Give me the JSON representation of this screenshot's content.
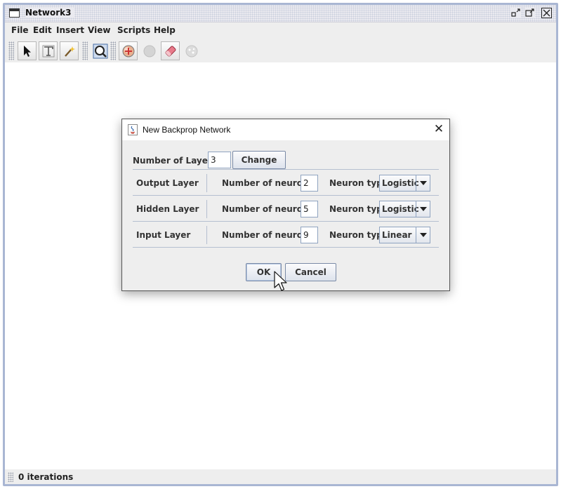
{
  "window": {
    "title": "Network3",
    "controls": [
      "restore-icon",
      "maximize-icon",
      "close-icon"
    ]
  },
  "menubar": {
    "items": [
      "File",
      "Edit",
      "Insert",
      "View",
      "Scripts",
      "Help"
    ]
  },
  "toolbar": {
    "tools": [
      "arrow-select-icon",
      "text-tool-icon",
      "wand-icon",
      "zoom-icon",
      "add-neuron-icon",
      "neuron-disabled-icon",
      "eraser-icon",
      "random-icon"
    ]
  },
  "status": {
    "text": "0 iterations"
  },
  "dialog": {
    "title": "New Backprop Network",
    "layers_label": "Number of Layers:",
    "layers_value": "3",
    "change_button": "Change",
    "neurons_label": "Number of neurons:",
    "type_label": "Neuron type:",
    "rows": [
      {
        "name": "Output Layer",
        "neurons": "2",
        "type": "Logistic"
      },
      {
        "name": "Hidden Layer",
        "neurons": "5",
        "type": "Logistic"
      },
      {
        "name": "Input Layer",
        "neurons": "9",
        "type": "Linear"
      }
    ],
    "ok_button": "OK",
    "cancel_button": "Cancel"
  }
}
